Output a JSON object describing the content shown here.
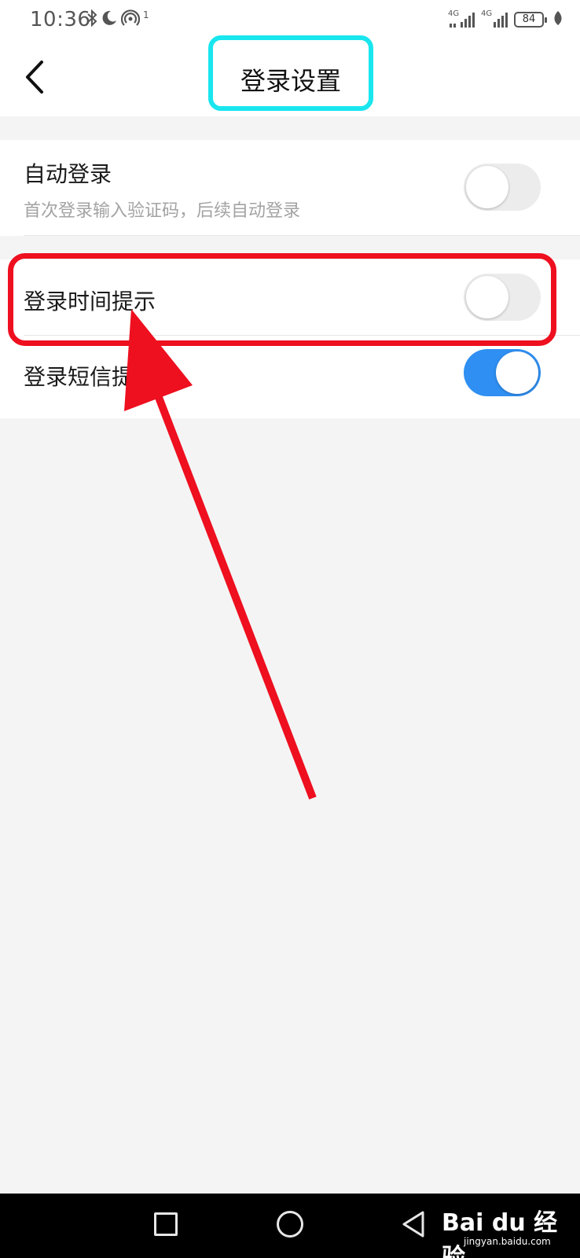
{
  "status_bar": {
    "time": "10:36",
    "left_icons": [
      "bluetooth-icon",
      "moon-icon",
      "hotspot-icon"
    ],
    "hotspot_count": "1",
    "signal_1_label": "4G",
    "signal_2_label": "4G",
    "battery": "84"
  },
  "header": {
    "title": "登录设置",
    "highlight_color": "#19e6ee"
  },
  "settings": [
    {
      "label": "自动登录",
      "description": "首次登录输入验证码，后续自动登录",
      "enabled": false
    },
    {
      "label": "登录时间提示",
      "enabled": false
    },
    {
      "label": "登录短信提",
      "enabled": true
    }
  ],
  "annotations": {
    "highlight_color": "#ee0f1f",
    "arrow_color": "#ee0f1f"
  },
  "colors": {
    "toggle_on": "#2f8ff2",
    "toggle_off": "#ececec",
    "background": "#f4f4f4"
  },
  "watermark": {
    "brand": "Bai du 经验",
    "site": "jingyan.baidu.com"
  }
}
